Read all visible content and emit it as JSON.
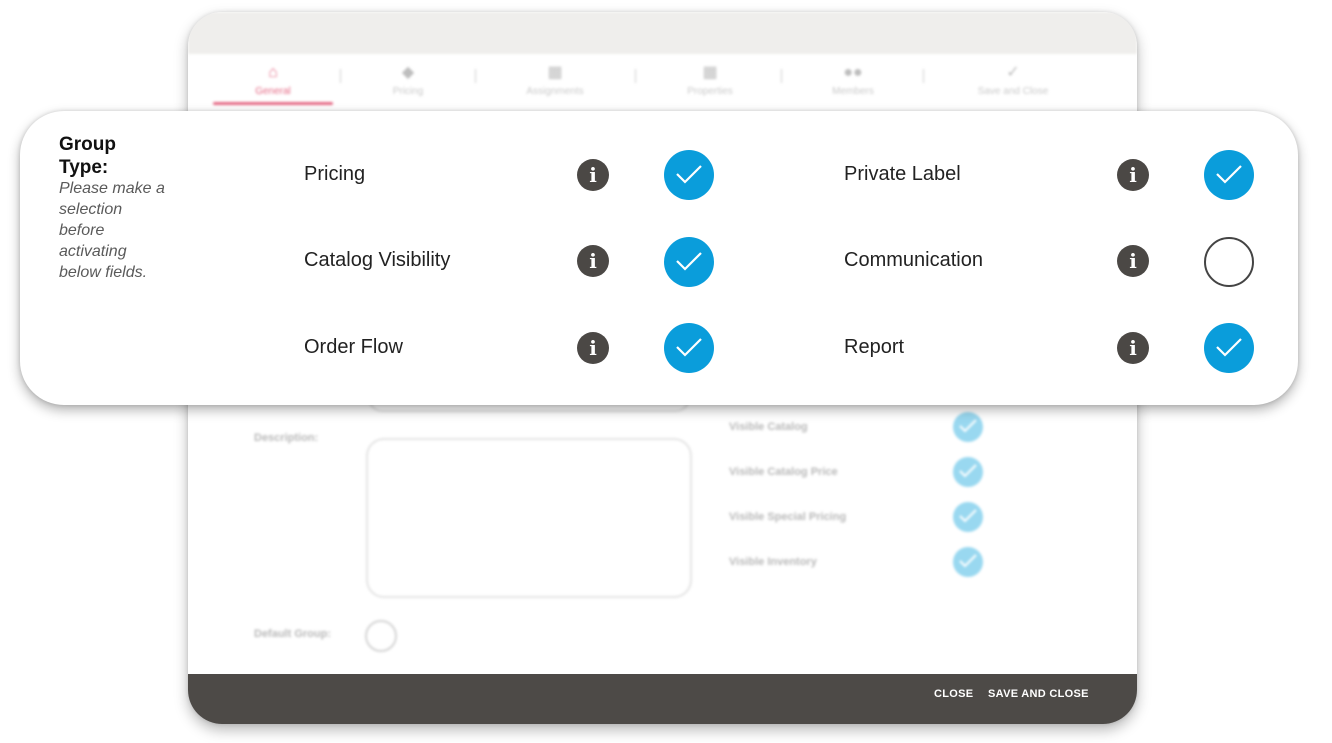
{
  "dialog": {
    "tabs": [
      {
        "label": "General",
        "icon": "home-icon",
        "active": true
      },
      {
        "label": "Pricing",
        "icon": "tag-icon",
        "active": false
      },
      {
        "label": "Assignments",
        "icon": "building-icon",
        "active": false
      },
      {
        "label": "Properties",
        "icon": "grid-icon",
        "active": false
      },
      {
        "label": "Members",
        "icon": "users-icon",
        "active": false
      },
      {
        "label": "Save and Close",
        "icon": "check-icon",
        "active": false
      }
    ],
    "description_label": "Description:",
    "default_group_label": "Default Group:",
    "default_group_checked": false,
    "visibility": [
      {
        "label": "Visible Catalog",
        "checked": true
      },
      {
        "label": "Visible Catalog Price",
        "checked": true
      },
      {
        "label": "Visible Special Pricing",
        "checked": true
      },
      {
        "label": "Visible Inventory",
        "checked": true
      }
    ],
    "footer": {
      "close_label": "CLOSE",
      "save_close_label": "SAVE AND CLOSE",
      "background": "#4d4a47"
    }
  },
  "group_type": {
    "title": "Group Type:",
    "note": "Please make a selection before activating below fields.",
    "options": [
      {
        "label": "Pricing",
        "checked": true
      },
      {
        "label": "Private Label",
        "checked": true
      },
      {
        "label": "Catalog Visibility",
        "checked": true
      },
      {
        "label": "Communication",
        "checked": false
      },
      {
        "label": "Order Flow",
        "checked": true
      },
      {
        "label": "Report",
        "checked": true
      }
    ],
    "check_color": "#0a9ddb",
    "info_icon_color": "#4b4845"
  },
  "accent_color": "#e56b86"
}
